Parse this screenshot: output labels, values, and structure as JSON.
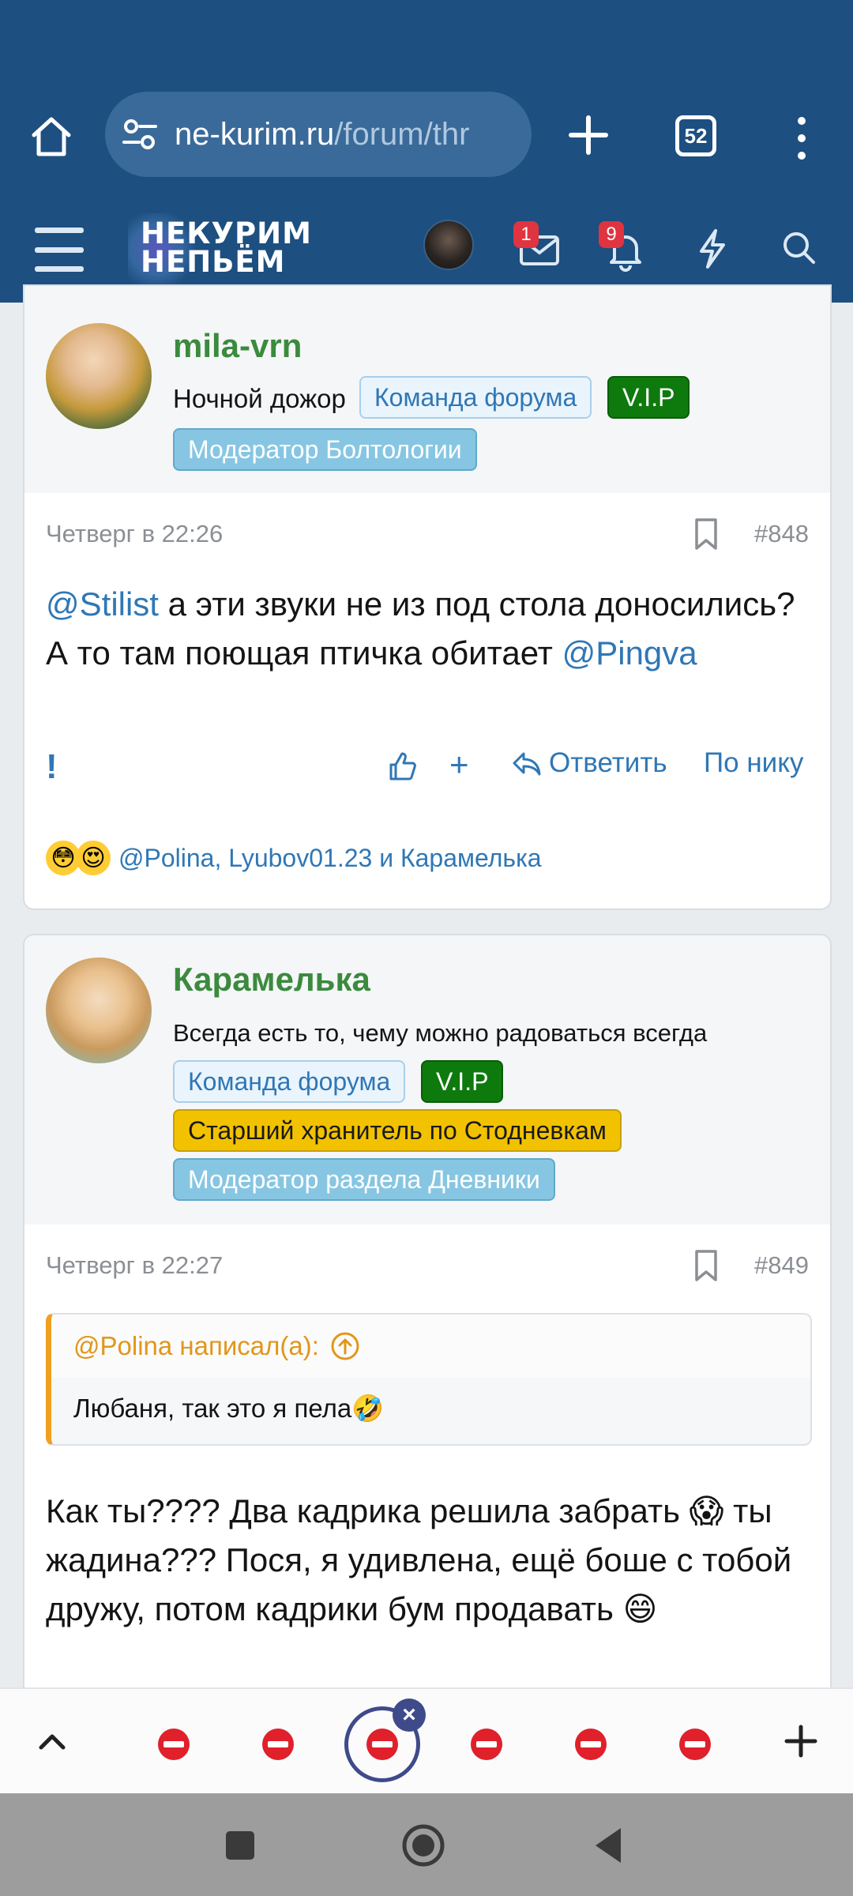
{
  "browser": {
    "url_host": "ne-kurim.ru",
    "url_path": "/forum/thr",
    "tab_count": "52"
  },
  "site": {
    "logo_line1": "НЕКУРИМ",
    "logo_line2": "НЕПЬЁМ",
    "inbox_count": "1",
    "alerts_count": "9"
  },
  "posts": [
    {
      "author": "mila-vrn",
      "user_title": "Ночной дожор",
      "banners": [
        "Команда форума",
        "V.I.P",
        "Модератор Болтологии"
      ],
      "date": "Четверг в 22:26",
      "number": "#848",
      "text_mention1": "@Stilist",
      "text_middle": " а эти звуки не из под стола доносились? А то там поющая птичка обитает ",
      "text_mention2": "@Pingva",
      "actions": {
        "report": "!",
        "plus": "+",
        "reply": "Ответить",
        "by_nick": "По нику"
      },
      "reactions_text": "@Polina, Lyubov01.23 и Карамелька"
    },
    {
      "author": "Карамелька",
      "user_title": "Всегда есть то, чему можно радоваться всегда",
      "banners": [
        "Команда форума",
        "V.I.P",
        "Старший хранитель по Стодневкам",
        "Модератор раздела Дневники"
      ],
      "date": "Четверг в 22:27",
      "number": "#849",
      "quote_author": "@Polina написал(а):",
      "quote_text": "Любаня, так это я пела🤣",
      "text": "Как ты???? Два кадрика решила забрать 😱 ты жадина??? Пося, я удивлена, ещё боше с тобой дружу, потом кадрики бум продавать 😄"
    }
  ],
  "colors": {
    "header_bg": "#1d4f80",
    "username": "#3b8a3e",
    "link": "#2f77b5",
    "vip": "#0e7a0d",
    "quote_accent": "#f0a020"
  }
}
